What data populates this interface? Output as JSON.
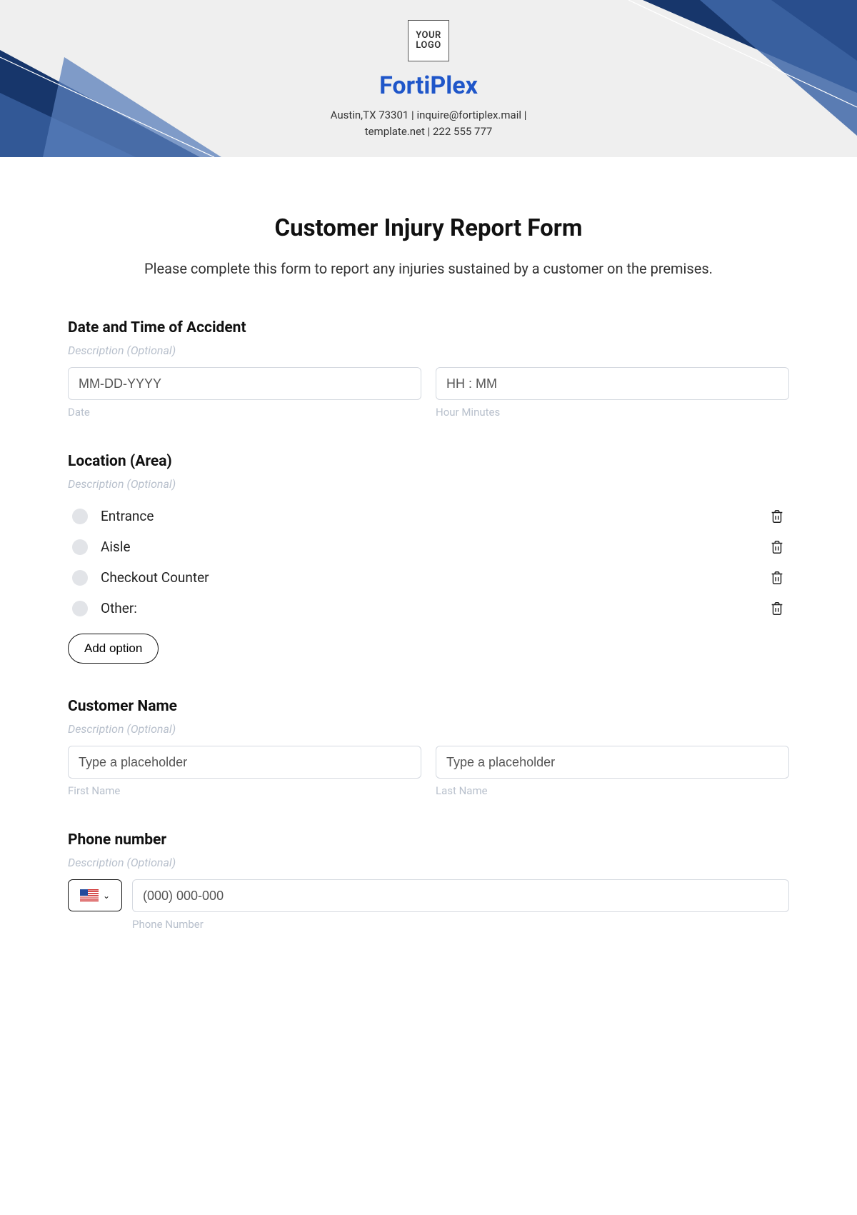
{
  "header": {
    "logo_text": "YOUR\nLOGO",
    "brand": "FortiPlex",
    "contact_line1": "Austin,TX 73301 | inquire@fortiplex.mail |",
    "contact_line2": "template.net | 222 555 777"
  },
  "form": {
    "title": "Customer Injury Report Form",
    "description": "Please complete this form to report any injuries sustained by a customer on the premises."
  },
  "s_datetime": {
    "title": "Date and Time of Accident",
    "desc": "Description (Optional)",
    "date_placeholder": "MM-DD-YYYY",
    "date_label": "Date",
    "time_placeholder": "HH : MM",
    "time_label": "Hour Minutes"
  },
  "s_location": {
    "title": "Location (Area)",
    "desc": "Description (Optional)",
    "options": [
      "Entrance",
      "Aisle",
      "Checkout Counter",
      "Other:"
    ],
    "add_label": "Add option"
  },
  "s_name": {
    "title": "Customer Name",
    "desc": "Description (Optional)",
    "first_placeholder": "Type a placeholder",
    "first_label": "First Name",
    "last_placeholder": "Type a placeholder",
    "last_label": "Last Name"
  },
  "s_phone": {
    "title": "Phone number",
    "desc": "Description (Optional)",
    "placeholder": "(000) 000-000",
    "label": "Phone Number"
  }
}
